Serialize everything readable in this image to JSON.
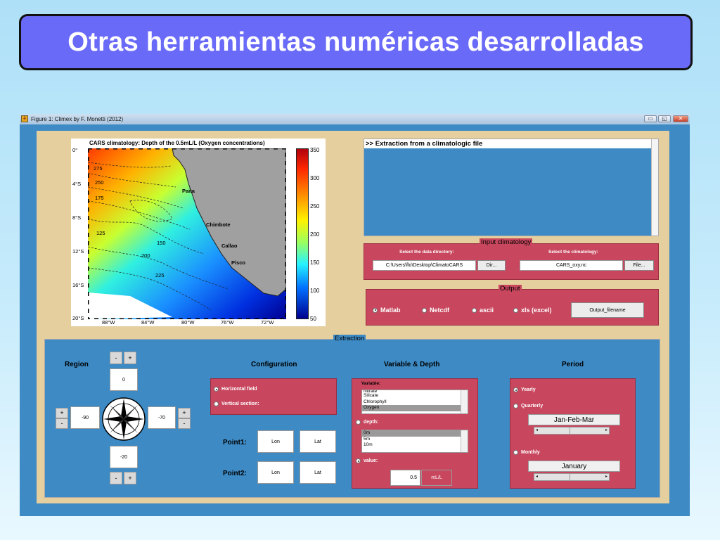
{
  "slide": {
    "title": "Otras herramientas numéricas desarrolladas"
  },
  "window": {
    "title": "Figure 1: Climex by F. Monetti (2012)",
    "controls": {
      "minimize": "▭",
      "restore": "◱",
      "close": "✕"
    }
  },
  "map": {
    "title": "CARS climatology: Depth of the 0.5mL/L (Oxygen concentrations)",
    "y_ticks": [
      "0°",
      "4°S",
      "8°S",
      "12°S",
      "16°S",
      "20°S"
    ],
    "x_ticks": [
      "88°W",
      "84°W",
      "80°W",
      "76°W",
      "72°W"
    ],
    "colorbar_ticks": [
      "350",
      "300",
      "250",
      "200",
      "150",
      "100",
      "50"
    ],
    "cities": [
      "Paita",
      "Chimbote",
      "Callao",
      "Pisco"
    ],
    "contour_labels": [
      "275",
      "250",
      "225",
      "200",
      "175",
      "150",
      "125"
    ]
  },
  "console": {
    "text": ">> Extraction from a climatologic file"
  },
  "input_climatology": {
    "label": "Input climatology",
    "dir_label": "Select the data directory:",
    "dir_value": "C:\\Users\\flo\\Desktop\\ClimatoCARS",
    "dir_button": "Dir...",
    "clim_label": "Select the climatology:",
    "clim_value": "CARS_oxy.nc",
    "file_button": "File..."
  },
  "output": {
    "label": "Output",
    "formats": [
      "Matlab",
      "Netcdf",
      "ascii",
      "xls (excel)"
    ],
    "selected": "Matlab",
    "filename_button": "Output_filename"
  },
  "extraction": {
    "label": "Extraction",
    "region": {
      "title": "Region",
      "north": "0",
      "south": "-20",
      "west": "-90",
      "east": "-70",
      "minus": "-",
      "plus": "+"
    },
    "configuration": {
      "title": "Configuration",
      "options": [
        "Horizontal field",
        "Vertical section:"
      ],
      "selected": "Horizontal field",
      "point1_label": "Point1:",
      "point2_label": "Point2:",
      "lon": "Lon",
      "lat": "Lat"
    },
    "variable_depth": {
      "title": "Variable & Depth",
      "variable_label": "Variable:",
      "variables": [
        "Nitrate",
        "Silicate",
        "Chlorophyll",
        "Oxygen"
      ],
      "selected_variable": "Oxygen",
      "depth_label": "depth:",
      "depths": [
        "0m",
        "5m",
        "10m"
      ],
      "selected_depth": "0m",
      "value_label": "value:",
      "value": "0.5",
      "unit": "mL/L"
    },
    "period": {
      "title": "Period",
      "options": [
        "Yearly",
        "Quarterly",
        "Monthly"
      ],
      "selected": "Yearly",
      "quarter_value": "Jan-Feb-Mar",
      "month_value": "January"
    }
  }
}
